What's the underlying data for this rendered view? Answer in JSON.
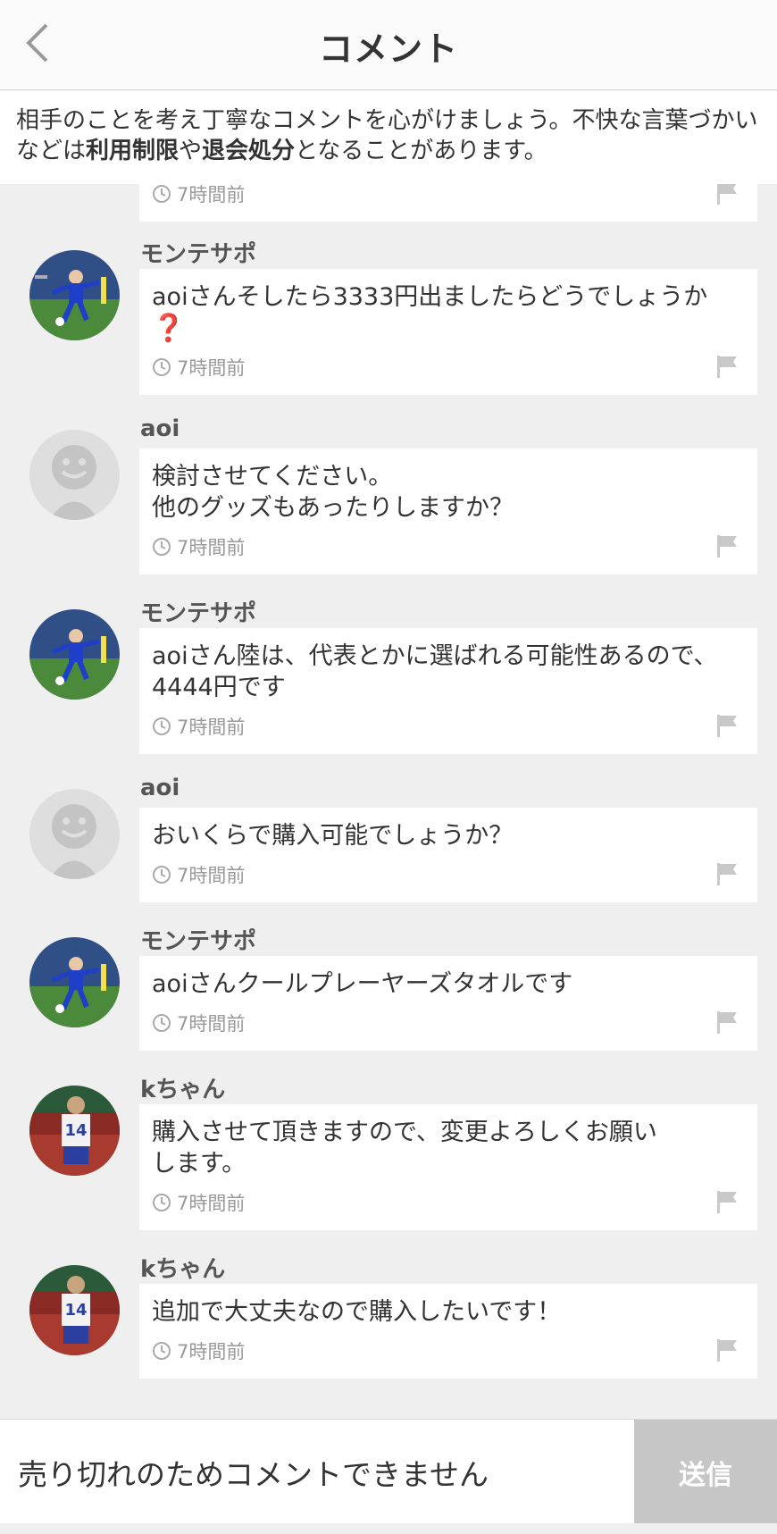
{
  "header": {
    "title": "コメント"
  },
  "notice": {
    "text_1": "相手のことを考え丁寧なコメントを心がけましょう。不快な言葉づかいなどは",
    "bold_1": "利用制限",
    "text_2": "や",
    "bold_2": "退会処分",
    "text_3": "となることがあります。"
  },
  "comments": [
    {
      "user": "",
      "text": "",
      "time": "7時間前",
      "avatar": "player-photo"
    },
    {
      "user": "モンテサポ",
      "text": "aoiさんそしたら3333円出ましたらどうでしょうか",
      "emoji": "❓",
      "time": "7時間前",
      "avatar": "player-photo"
    },
    {
      "user": "aoi",
      "text": "検討させてください。\n他のグッズもあったりしますか？",
      "time": "7時間前",
      "avatar": "default"
    },
    {
      "user": "モンテサポ",
      "text": "aoiさん陸は、代表とかに選ばれる可能性あるので、\n4444円です",
      "time": "7時間前",
      "avatar": "player-photo"
    },
    {
      "user": "aoi",
      "text": "おいくらで購入可能でしょうか？",
      "time": "7時間前",
      "avatar": "default"
    },
    {
      "user": "モンテサポ",
      "text": "aoiさんクールプレーヤーズタオルです",
      "time": "7時間前",
      "avatar": "player-photo"
    },
    {
      "user": "kちゃん",
      "text": "購入させて頂きますので、変更よろしくお願い\nします。",
      "time": "7時間前",
      "avatar": "player-14-photo"
    },
    {
      "user": "kちゃん",
      "text": "追加で大丈夫なので購入したいです！",
      "time": "7時間前",
      "avatar": "player-14-photo"
    }
  ],
  "footer": {
    "input_text": "売り切れのためコメントできません",
    "send_label": "送信"
  },
  "colors": {
    "background": "#efefef",
    "send_disabled": "#c6c6c6",
    "text": "#333333",
    "meta": "#999999"
  }
}
